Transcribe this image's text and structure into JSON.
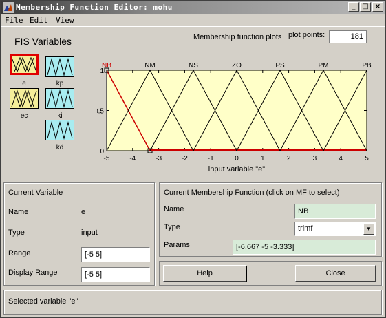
{
  "window": {
    "title": "Membership Function Editor: mohu"
  },
  "menu": [
    "File",
    "Edit",
    "View"
  ],
  "fis": {
    "title": "FIS Variables",
    "inputs": [
      {
        "label": "e",
        "selected": true
      },
      {
        "label": "ec",
        "selected": false
      }
    ],
    "outputs": [
      {
        "label": "kp"
      },
      {
        "label": "ki"
      },
      {
        "label": "kd"
      }
    ]
  },
  "plot": {
    "title": "Membership function plots",
    "plot_points_label": "plot points:",
    "plot_points_value": "181"
  },
  "chart_data": {
    "type": "line",
    "xlabel": "input variable \"e\"",
    "ylabel": "",
    "xlim": [
      -5,
      5
    ],
    "ylim": [
      0,
      1
    ],
    "xticks": [
      "-5",
      "-4",
      "-3",
      "-2",
      "-1",
      "0",
      "1",
      "2",
      "3",
      "4",
      "5"
    ],
    "yticks": [
      "0",
      "0.5",
      "1"
    ],
    "series": [
      {
        "name": "NB",
        "x": [
          -6.667,
          -5,
          -3.333
        ],
        "y": [
          0,
          1,
          0
        ],
        "selected": true
      },
      {
        "name": "NM",
        "x": [
          -5,
          -3.333,
          -1.667
        ],
        "y": [
          0,
          1,
          0
        ]
      },
      {
        "name": "NS",
        "x": [
          -3.333,
          -1.667,
          0
        ],
        "y": [
          0,
          1,
          0
        ]
      },
      {
        "name": "ZO",
        "x": [
          -1.667,
          0,
          1.667
        ],
        "y": [
          0,
          1,
          0
        ]
      },
      {
        "name": "PS",
        "x": [
          0,
          1.667,
          3.333
        ],
        "y": [
          0,
          1,
          0
        ]
      },
      {
        "name": "PM",
        "x": [
          1.667,
          3.333,
          5
        ],
        "y": [
          0,
          1,
          0
        ]
      },
      {
        "name": "PB",
        "x": [
          3.333,
          5,
          6.667
        ],
        "y": [
          0,
          1,
          0
        ]
      }
    ],
    "colors": {
      "background": "#ffffc8",
      "line": "#000000",
      "selected": "#cc0000"
    }
  },
  "current_variable": {
    "title": "Current Variable",
    "name_label": "Name",
    "name_value": "e",
    "type_label": "Type",
    "type_value": "input",
    "range_label": "Range",
    "range_value": "[-5 5]",
    "display_range_label": "Display Range",
    "display_range_value": "[-5 5]"
  },
  "current_mf": {
    "title": "Current Membership Function (click on MF to select)",
    "name_label": "Name",
    "name_value": "NB",
    "type_label": "Type",
    "type_value": "trimf",
    "params_label": "Params",
    "params_value": "[-6.667 -5 -3.333]"
  },
  "buttons": {
    "help": "Help",
    "close": "Close"
  },
  "status": "Selected variable \"e\""
}
